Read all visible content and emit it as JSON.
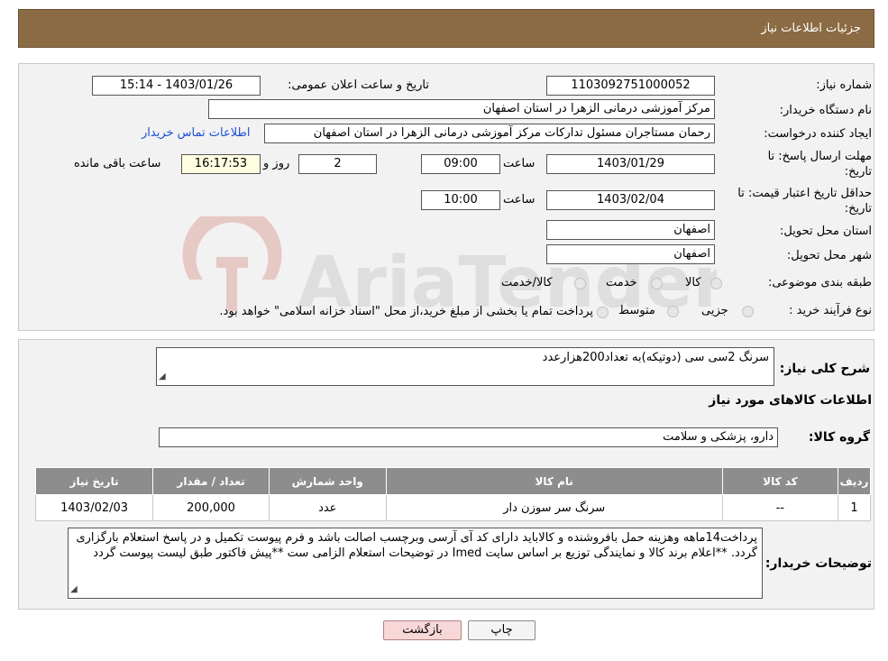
{
  "header": {
    "title": "جزئيات اطلاعات نياز"
  },
  "details": {
    "need_number_label": "شماره نیاز:",
    "need_number": "1103092751000052",
    "announce_label": "تاریخ و ساعت اعلان عمومی:",
    "announce_value": "1403/01/26 - 15:14",
    "buyer_org_label": "نام دستگاه خریدار:",
    "buyer_org": "مرکز آموزشی درمانی الزهرا در استان اصفهان",
    "creator_label": "ایجاد کننده درخواست:",
    "creator": "رحمان مستاجران مسئول تدارکات مرکز آموزشی درمانی الزهرا در استان اصفهان",
    "contact_link": "اطلاعات تماس خریدار",
    "deadline_label_1": "مهلت ارسال پاسخ: تا",
    "deadline_label_2": "تاریخ:",
    "deadline_date": "1403/01/29",
    "time_label": "ساعت",
    "deadline_time": "09:00",
    "days_value": "2",
    "days_label": "روز و",
    "remaining_time": "16:17:53",
    "remaining_label": "ساعت باقی مانده",
    "validity_label_1": "حداقل تاریخ اعتبار قیمت: تا",
    "validity_label_2": "تاریخ:",
    "validity_date": "1403/02/04",
    "validity_time": "10:00",
    "province_label": "استان محل تحویل:",
    "province": "اصفهان",
    "city_label": "شهر محل تحویل:",
    "city": "اصفهان",
    "category_label": "طبقه بندی موضوعی:",
    "category_options": [
      "کالا",
      "خدمت",
      "کالا/خدمت"
    ],
    "process_label": "نوع فرآیند خرید :",
    "process_options": [
      "جزیی",
      "متوسط"
    ],
    "process_note": "پرداخت تمام یا بخشی از مبلغ خرید،از محل \"اسناد خزانه اسلامی\" خواهد بود."
  },
  "summary": {
    "description_label": "شرح کلی نیاز:",
    "description": "سرنگ 2سی سی (دوتیکه)به تعداد200هزارعدد",
    "goods_info_title": "اطلاعات کالاهای مورد نیاز",
    "goods_group_label": "گروه کالا:",
    "goods_group": "دارو، پزشکی و سلامت",
    "table": {
      "headers": [
        "ردیف",
        "کد کالا",
        "نام کالا",
        "واحد شمارش",
        "تعداد / مقدار",
        "تاریخ نیاز"
      ],
      "rows": [
        [
          "1",
          "--",
          "سرنگ سر سوزن دار",
          "عدد",
          "200,000",
          "1403/02/03"
        ]
      ]
    },
    "buyer_notes_label": "توضیحات خریدار:",
    "buyer_notes": "پرداخت14ماهه وهزینه حمل بافروشنده و کالاباید دارای کد آی آرسی وبرچسب اصالت باشد و فرم پیوست تکمیل و در پاسخ استعلام بارگزاری گردد. **اعلام برند کالا و نمایندگی توزیع بر اساس سایت Imed در توضیحات استعلام الزامی ست **پیش فاکتور طبق لیست پیوست گردد"
  },
  "buttons": {
    "print": "چاپ",
    "back": "بازگشت"
  },
  "watermark_text": "AriaTender.neT",
  "colors": {
    "header": "#8b6b43",
    "link": "#1a4fd6",
    "table_header": "#8d8d8d",
    "back_button": "#f7d7d7"
  }
}
